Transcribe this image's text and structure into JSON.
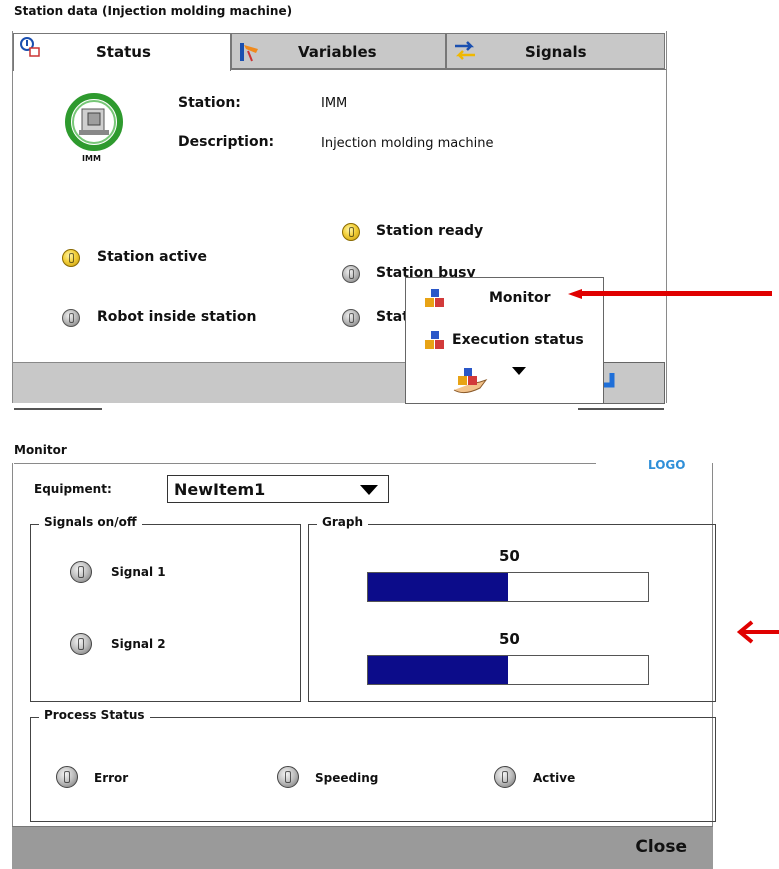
{
  "station_window": {
    "title": "Station data (Injection molding machine)",
    "tabs": [
      {
        "label": "Status",
        "icon": "status-icon",
        "active": true
      },
      {
        "label": "Variables",
        "icon": "variables-icon",
        "active": false
      },
      {
        "label": "Signals",
        "icon": "signals-icon",
        "active": false
      }
    ],
    "station_badge": "IMM",
    "fields": [
      {
        "label": "Station:",
        "value": "IMM"
      },
      {
        "label": "Description:",
        "value": "Injection molding machine"
      }
    ],
    "statuses": [
      {
        "label": "Station active",
        "state": "on"
      },
      {
        "label": "Robot inside station",
        "state": "off"
      },
      {
        "label": "Station ready",
        "state": "on"
      },
      {
        "label": "Station busy",
        "state": "off"
      },
      {
        "label": "Stat",
        "state": "off"
      }
    ],
    "popup_menu": {
      "items": [
        {
          "label": "Monitor",
          "icon": "cubes-icon"
        },
        {
          "label": "Execution status",
          "icon": "cubes-icon"
        }
      ],
      "expand_icon": "hand-cubes-icon"
    },
    "enter_icon": "enter-arrow-icon"
  },
  "monitor_window": {
    "title": "Monitor",
    "logo": "LOGO",
    "equipment_label": "Equipment:",
    "equipment_value": "NewItem1",
    "signals_group": {
      "title": "Signals on/off",
      "signals": [
        {
          "label": "Signal 1",
          "state": "off"
        },
        {
          "label": "Signal 2",
          "state": "off"
        }
      ]
    },
    "graph_group": {
      "title": "Graph",
      "bars": [
        {
          "value": "50",
          "fraction": 0.5
        },
        {
          "value": "50",
          "fraction": 0.5
        }
      ]
    },
    "process_group": {
      "title": "Process Status",
      "items": [
        {
          "label": "Error",
          "state": "off"
        },
        {
          "label": "Speeding",
          "state": "off"
        },
        {
          "label": "Active",
          "state": "off"
        }
      ]
    },
    "close_label": "Close"
  },
  "colors": {
    "annotation_arrow": "#e00000",
    "bar_fill": "#0c0c8a",
    "logo": "#2f8fd8",
    "status_on": "#f2cf3a",
    "status_off": "#b8b8b8"
  }
}
